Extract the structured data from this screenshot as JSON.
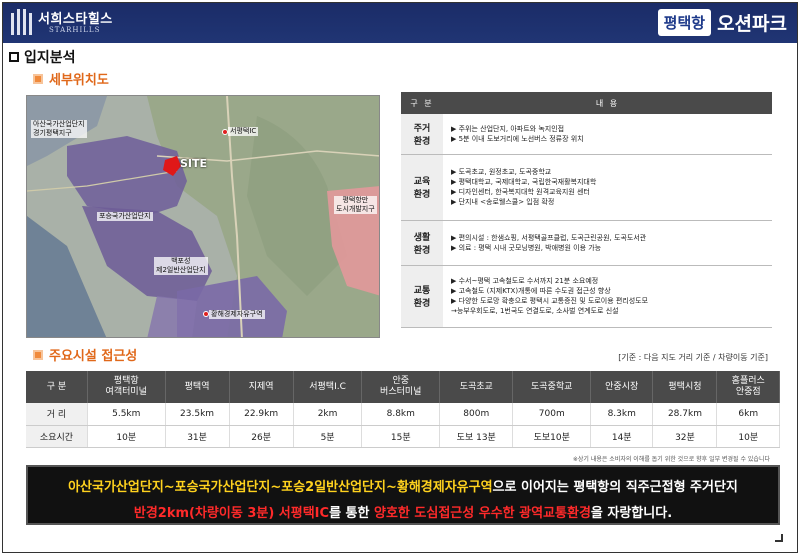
{
  "header": {
    "brand_kr": "서희스타힐스",
    "brand_en": "STARHILLS",
    "project_a": "평택항",
    "project_b": "오션파크"
  },
  "section_title": "입지분석",
  "map_section": {
    "title": "세부위치도",
    "labels": {
      "asan": "아산국가산업단지\n경기평택지구",
      "seopyeongtaek_ic": "서평택IC",
      "site": "SITE",
      "pogseung": "포승국가산업단지",
      "baekposeong": "백포성\n제2일반산업단지",
      "free_zone": "황해경제자유구역",
      "pyeongtaek_port": "평택항만\n도시개발지구"
    }
  },
  "info_table": {
    "header": [
      "구 분",
      "내 용"
    ],
    "rows": [
      {
        "category": "주거\n환경",
        "items": [
          "▶ 주위는 산업단지, 아파트와 녹지인접",
          "▶ 5분 이내 도보거리에 노선버스 정류장 위치"
        ]
      },
      {
        "category": "교육\n환경",
        "items": [
          "▶ 도곡초교, 원정초교, 도곡중학교",
          "▶ 평택대학교, 국제대학교, 국립한국재활복지대학",
          "▶ 디자인센터, 한국복지대학 원격교육지원 센터",
          "▶ 단지내 <송로웰스쿨> 입점 확정"
        ]
      },
      {
        "category": "생활\n환경",
        "items": [
          "▶ 편의시설 : 한샘쇼핑, 서평택골프클럽, 도곡근린공원, 도곡도서관",
          "▶ 의료 : 평택 시내 굿모닝병원, 박애병원 이용 가능"
        ]
      },
      {
        "category": "교통\n환경",
        "items": [
          "▶ 수서~평택 고속철도로 수서까지 21분 소요예정",
          "▶ 고속철도 (지제KTX)개통에 따른 수도권 접근성 향상",
          "▶ 다양한 도로망 확충으로 평택시 교통증진 및 도로이용 편리성도모",
          "  →능부우회도로, 1번국도 연결도로, 소사벌 연계도로 신설"
        ]
      }
    ]
  },
  "access_section": {
    "title": "주요시설 접근성",
    "criteria": "[기준 : 다음 지도 거리 기준 / 차량이동 기준]",
    "columns": [
      "구 분",
      "평택항\n여객터미널",
      "평택역",
      "지제역",
      "서평택I.C",
      "안중\n버스터미널",
      "도곡초교",
      "도곡중학교",
      "안중시장",
      "평택시청",
      "홈플러스\n안중점"
    ],
    "rows": [
      {
        "label": "거 리",
        "values": [
          "5.5km",
          "23.5km",
          "22.9km",
          "2km",
          "8.8km",
          "800m",
          "700m",
          "8.3km",
          "28.7km",
          "6km"
        ]
      },
      {
        "label": "소요시간",
        "values": [
          "10분",
          "31분",
          "26분",
          "5분",
          "15분",
          "도보 13분",
          "도보10분",
          "14분",
          "32분",
          "10분"
        ]
      }
    ],
    "note": "※상기 내용은 소비자의 이해를 돕기 위한 것으로 향후 일부 변경될 수 있습니다"
  },
  "banner": {
    "line1_yellow": "아산국가산업단지~포승국가산업단지~포승2일반산업단지~황해경제자유구역",
    "line1_white": "으로 이어지는 평택항의 직주근접형 주거단지",
    "line2_red1": "반경2km(차량이동 3분) 서평택IC",
    "line2_white1": "를 통한 ",
    "line2_red2": "양호한 도심접근성 우수한 광역교통환경",
    "line2_white2": "을 자랑합니다."
  },
  "colors": {
    "header_bg": "#1b2c68",
    "accent_orange": "#e0681a",
    "table_header": "#4a4a4a",
    "banner_yellow": "#ffd21e",
    "banner_red": "#ff2a2a"
  }
}
